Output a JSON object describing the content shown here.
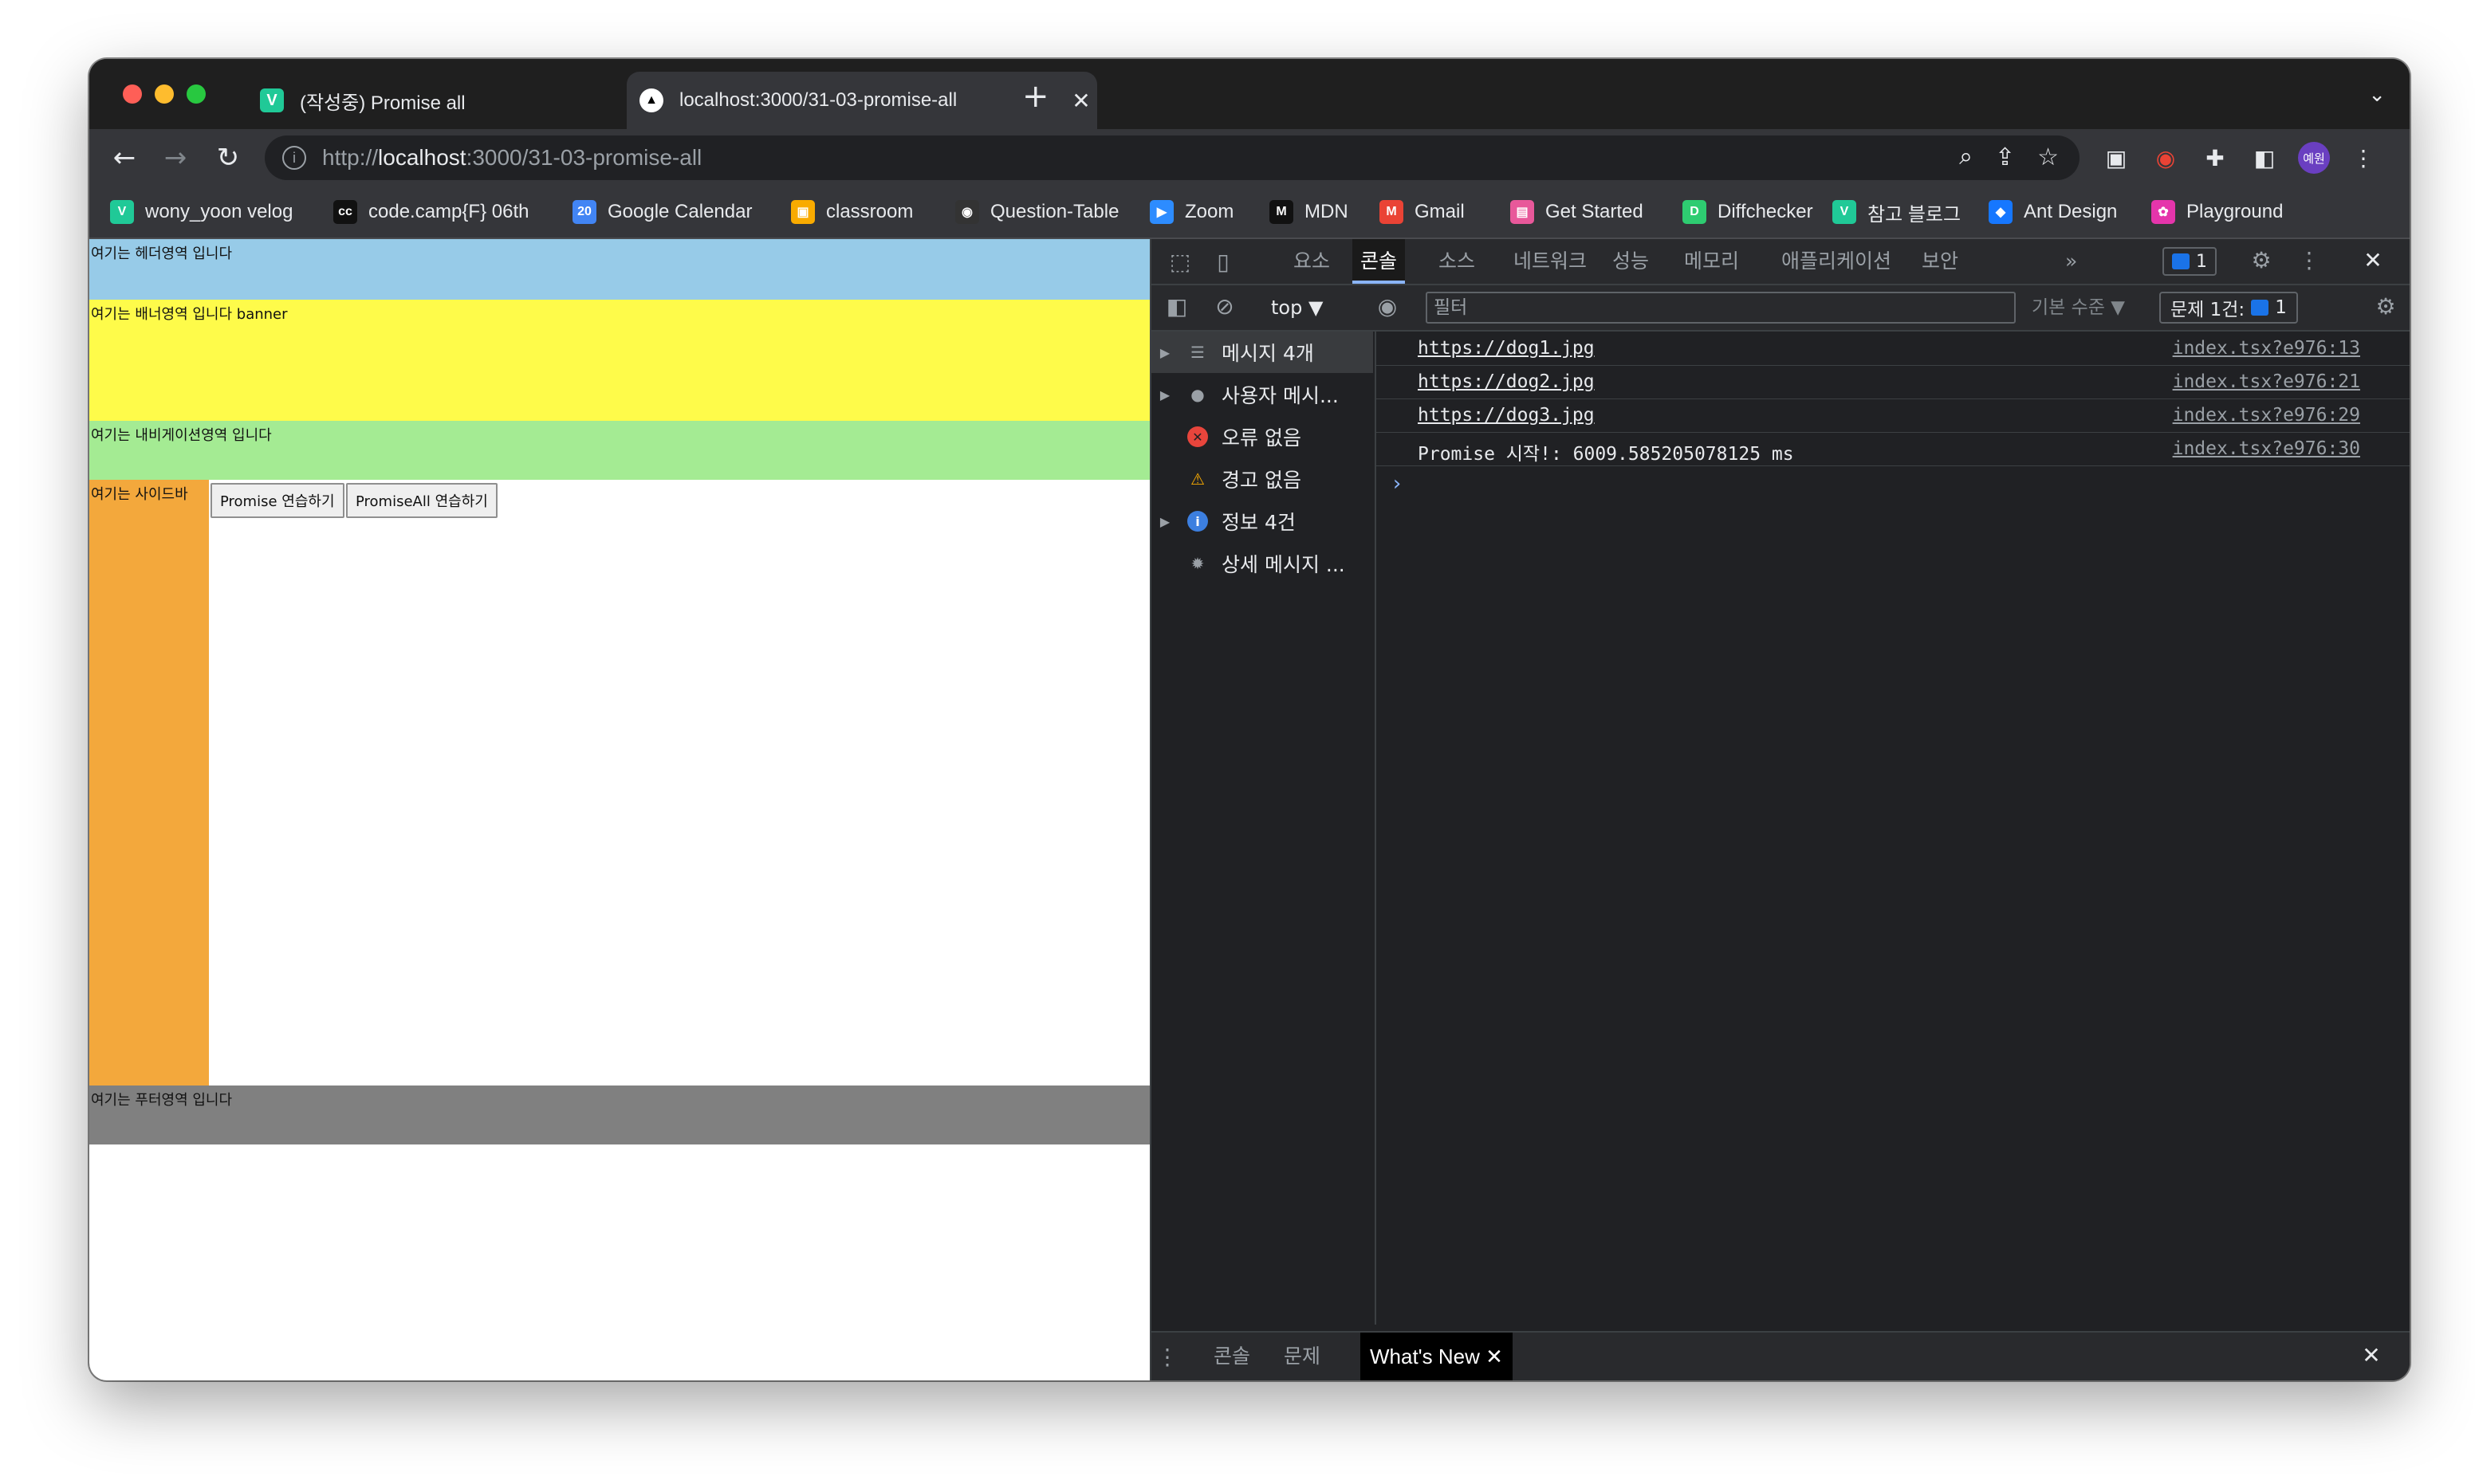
{
  "browser": {
    "tabs": [
      {
        "title": "(작성중) Promise all",
        "favicon": "V",
        "favicon_color": "#20c997",
        "close": "✕"
      },
      {
        "title": "localhost:3000/31-03-promise-all",
        "favicon": "▲",
        "favicon_color": "#000000",
        "close": "✕"
      }
    ],
    "new_tab": "+",
    "tab_menu": "⌄",
    "url_scheme": "http://",
    "url_host": "localhost",
    "url_path": ":3000/31-03-promise-all",
    "profile": "예원"
  },
  "bookmarks": [
    {
      "label": "wony_yoon velog",
      "icon": "V",
      "color": "#20c997"
    },
    {
      "label": "code.camp{F} 06th",
      "icon": "cc",
      "color": "#111111"
    },
    {
      "label": "Google Calendar",
      "icon": "20",
      "color": "#4285f4"
    },
    {
      "label": "classroom",
      "icon": "▣",
      "color": "#f9ab00"
    },
    {
      "label": "Question-Table",
      "icon": "◉",
      "color": "#333333"
    },
    {
      "label": "Zoom",
      "icon": "▶",
      "color": "#2d8cff"
    },
    {
      "label": "MDN",
      "icon": "M",
      "color": "#111111"
    },
    {
      "label": "Gmail",
      "icon": "M",
      "color": "#ea4335"
    },
    {
      "label": "Get Started",
      "icon": "▤",
      "color": "#e8589a"
    },
    {
      "label": "Diffchecker",
      "icon": "D",
      "color": "#2ecc71"
    },
    {
      "label": "참고 블로그",
      "icon": "V",
      "color": "#20c997"
    },
    {
      "label": "Ant Design",
      "icon": "◆",
      "color": "#1677ff"
    },
    {
      "label": "Playground",
      "icon": "✿",
      "color": "#e535ab"
    }
  ],
  "page": {
    "header": "여기는 헤더영역 입니다",
    "banner": "여기는 배너영역 입니다 banner",
    "nav": "여기는 내비게이션영역 입니다",
    "sidebar": "여기는 사이드바",
    "button_promise": "Promise 연습하기",
    "button_promise_all": "PromiseAll 연습하기",
    "footer": "여기는 푸터영역 입니다"
  },
  "devtools": {
    "tabs": [
      "요소",
      "콘솔",
      "소스",
      "네트워크",
      "성능",
      "메모리",
      "애플리케이션",
      "보안"
    ],
    "active_tab": "콘솔",
    "more_tabs": "»",
    "issues_badge": "1",
    "context": "top ▼",
    "filter_placeholder": "필터",
    "levels": "기본 수준 ▼",
    "issue_count": "문제 1건:",
    "issue_count_num": "1",
    "sidebar": [
      {
        "label": "메시지 4개",
        "icon": "list-icon",
        "expandable": true
      },
      {
        "label": "사용자 메시...",
        "icon": "user-icon",
        "expandable": true
      },
      {
        "label": "오류 없음",
        "icon": "error-icon",
        "expandable": false
      },
      {
        "label": "경고 없음",
        "icon": "warning-icon",
        "expandable": false
      },
      {
        "label": "정보 4건",
        "icon": "info-icon",
        "expandable": true
      },
      {
        "label": "상세 메시지 ...",
        "icon": "bug-icon",
        "expandable": false
      }
    ],
    "logs": [
      {
        "message": "https://dog1.jpg",
        "source": "index.tsx?e976:13",
        "link": true
      },
      {
        "message": "https://dog2.jpg",
        "source": "index.tsx?e976:21",
        "link": true
      },
      {
        "message": "https://dog3.jpg",
        "source": "index.tsx?e976:29",
        "link": true
      },
      {
        "message": "Promise 시작!: 6009.585205078125 ms",
        "source": "index.tsx?e976:30",
        "link": false
      }
    ],
    "prompt": "›",
    "drawer_tabs": [
      "콘솔",
      "문제",
      "What's New"
    ],
    "drawer_close": "✕",
    "close": "✕"
  }
}
